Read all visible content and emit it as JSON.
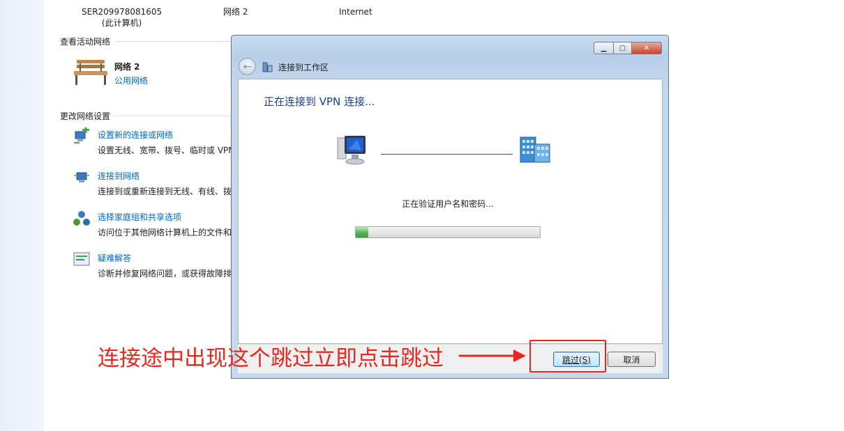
{
  "network_map": {
    "computer_name": "SER209978081605",
    "computer_note": "(此计算机)",
    "network_name": "网络  2",
    "internet": "Internet"
  },
  "active_networks": {
    "header": "查看活动网络",
    "network_name": "网络  2",
    "network_type": "公用网络"
  },
  "change_settings": {
    "header": "更改网络设置",
    "tasks": [
      {
        "label": "设置新的连接或网络",
        "desc": "设置无线、宽带、拨号、临时或 VPN",
        "icon": "new-connection-icon"
      },
      {
        "label": "连接到网络",
        "desc": "连接到或重新连接到无线、有线、拨",
        "icon": "connect-network-icon"
      },
      {
        "label": "选择家庭组和共享选项",
        "desc": "访问位于其他网络计算机上的文件和",
        "icon": "homegroup-icon"
      },
      {
        "label": "疑难解答",
        "desc": "诊断并修复网络问题，或获得故障排",
        "icon": "troubleshoot-icon"
      }
    ]
  },
  "dialog": {
    "title": "连接到工作区",
    "heading": "正在连接到 VPN 连接...",
    "status": "正在验证用户名和密码...",
    "progress": 0.07,
    "skip_label": "跳过(S)",
    "cancel_label": "取消",
    "controls": {
      "minimize": "▁",
      "maximize": "▢",
      "close": "✕"
    }
  },
  "annotation": {
    "text": "连接途中出现这个跳过立即点击跳过",
    "color": "#e8281e"
  }
}
